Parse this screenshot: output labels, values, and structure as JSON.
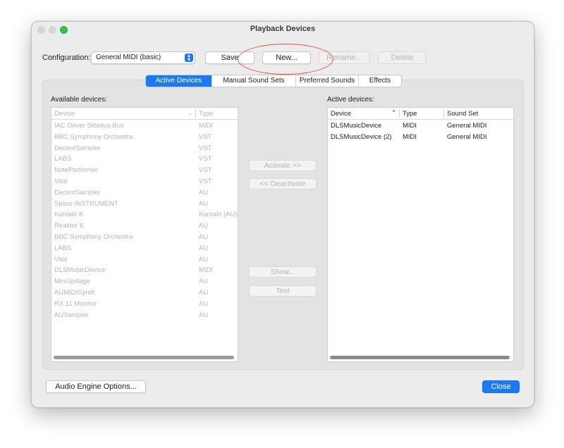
{
  "window": {
    "title": "Playback Devices"
  },
  "config": {
    "label": "Configuration:",
    "value": "General MIDI (basic)"
  },
  "buttons": {
    "save": "Save",
    "new": "New...",
    "rename": "Rename...",
    "delete": "Delete",
    "activate": "Activate >>",
    "deactivate": "<< Deactivate",
    "show": "Show...",
    "test": "Test",
    "audio_engine": "Audio Engine Options...",
    "close": "Close"
  },
  "tabs": [
    "Active Devices",
    "Manual Sound Sets",
    "Preferred Sounds",
    "Effects"
  ],
  "available": {
    "label": "Available devices:",
    "headers": [
      "Device",
      "Type"
    ],
    "rows": [
      [
        "IAC Driver Sibelius Bus",
        "MIDI"
      ],
      [
        "BBC Symphony Orchestra",
        "VST"
      ],
      [
        "DecentSampler",
        "VST"
      ],
      [
        "LABS",
        "VST"
      ],
      [
        "NotePerformer",
        "VST"
      ],
      [
        "Vital",
        "VST"
      ],
      [
        "DecentSampler",
        "AU"
      ],
      [
        "Splice INSTRUMENT",
        "AU"
      ],
      [
        "Kontakt 8",
        "Kontakt (AU)"
      ],
      [
        "Reaktor 6",
        "AU"
      ],
      [
        "BBC Symphony Orchestra",
        "AU"
      ],
      [
        "LABS",
        "AU"
      ],
      [
        "Vital",
        "AU"
      ],
      [
        "DLSMusicDevice",
        "MIDI"
      ],
      [
        "MiniSpillage",
        "AU"
      ],
      [
        "AUMIDISynth",
        "AU"
      ],
      [
        "RX 11 Monitor",
        "AU"
      ],
      [
        "AUSampler",
        "AU"
      ]
    ]
  },
  "active": {
    "label": "Active devices:",
    "headers": [
      "Device",
      "Type",
      "Sound Set"
    ],
    "rows": [
      [
        "DLSMusicDevice",
        "MIDI",
        "General MIDI"
      ],
      [
        "DLSMusicDevice (2)",
        "MIDI",
        "General MIDI"
      ]
    ]
  },
  "icons": {
    "popup_arrow": "updown-chevron-icon",
    "sort": "chevron-icon"
  },
  "colors": {
    "accent": "#1a7af5",
    "annotation": "#e2553f"
  }
}
